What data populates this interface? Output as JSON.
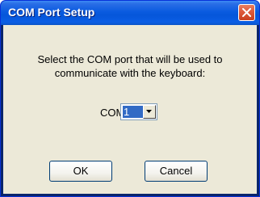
{
  "window": {
    "title": "COM Port Setup"
  },
  "dialog": {
    "message_line1": "Select the COM port that will be used to",
    "message_line2": "communicate with the keyboard:",
    "com_label": "COM:",
    "com_value": "1"
  },
  "buttons": {
    "ok_label": "OK",
    "cancel_label": "Cancel"
  },
  "colors": {
    "title_bar": "#0a5be0",
    "client_background": "#ece9d8",
    "close_button": "#de5a3c",
    "selection": "#316ac5"
  },
  "icons": {
    "close": "close-icon",
    "dropdown": "chevron-down-icon"
  }
}
